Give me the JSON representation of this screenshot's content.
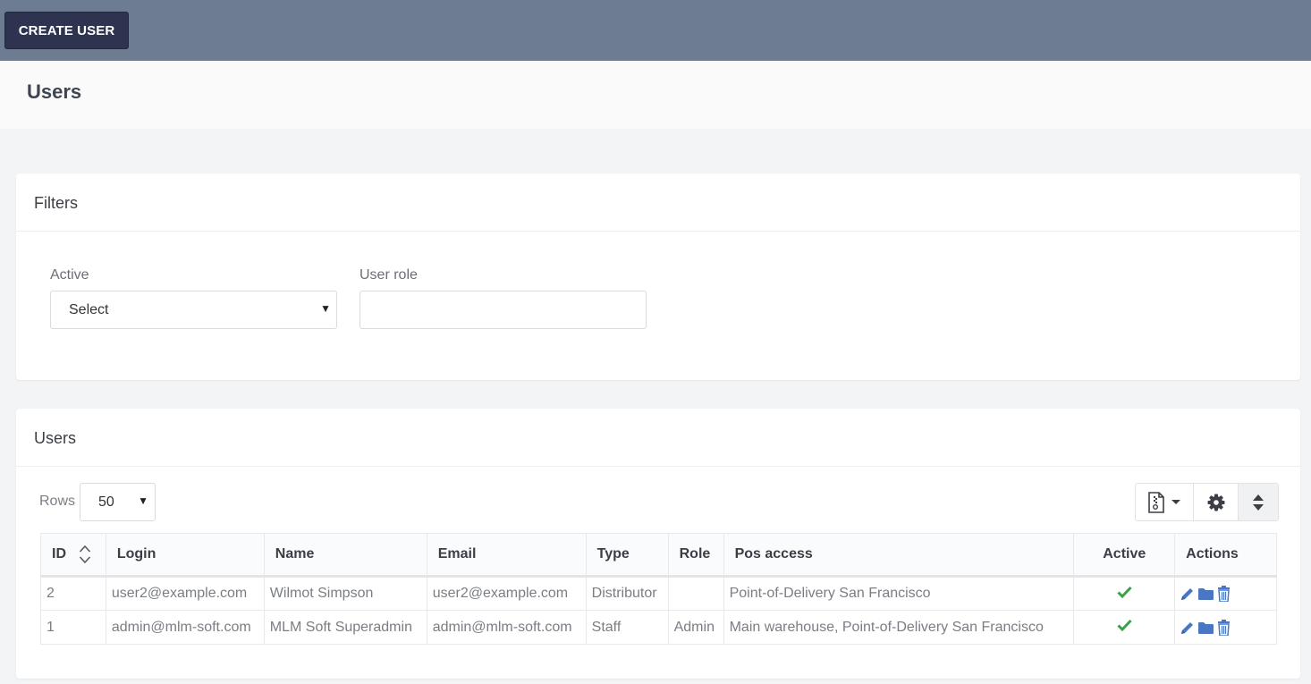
{
  "toolbar": {
    "create_user_label": "CREATE USER"
  },
  "page": {
    "title": "Users"
  },
  "filters": {
    "title": "Filters",
    "active_label": "Active",
    "active_value": "Select",
    "user_role_label": "User role",
    "user_role_value": ""
  },
  "users": {
    "title": "Users",
    "rows_label": "Rows",
    "rows_value": "50",
    "columns": [
      "ID",
      "Login",
      "Name",
      "Email",
      "Type",
      "Role",
      "Pos access",
      "Active",
      "Actions"
    ],
    "rows": [
      {
        "id": "2",
        "login": "user2@example.com",
        "name": "Wilmot Simpson",
        "email": "user2@example.com",
        "type": "Distributor",
        "role": "",
        "pos_access": "Point-of-Delivery San Francisco",
        "active": true
      },
      {
        "id": "1",
        "login": "admin@mlm-soft.com",
        "name": "MLM Soft Superadmin",
        "email": "admin@mlm-soft.com",
        "type": "Staff",
        "role": "Admin",
        "pos_access": "Main warehouse, Point-of-Delivery San Francisco",
        "active": true
      }
    ]
  },
  "icons": {
    "export": "file-export-icon",
    "settings": "gear-icon",
    "sort": "sort-icon",
    "active": "check-icon",
    "edit": "pencil-icon",
    "folder": "folder-icon",
    "delete": "trash-icon"
  },
  "colors": {
    "topbar": "#6e7c91",
    "primary_button": "#2e3450",
    "check": "#3aa04a",
    "action_icons": "#4a77c4"
  }
}
